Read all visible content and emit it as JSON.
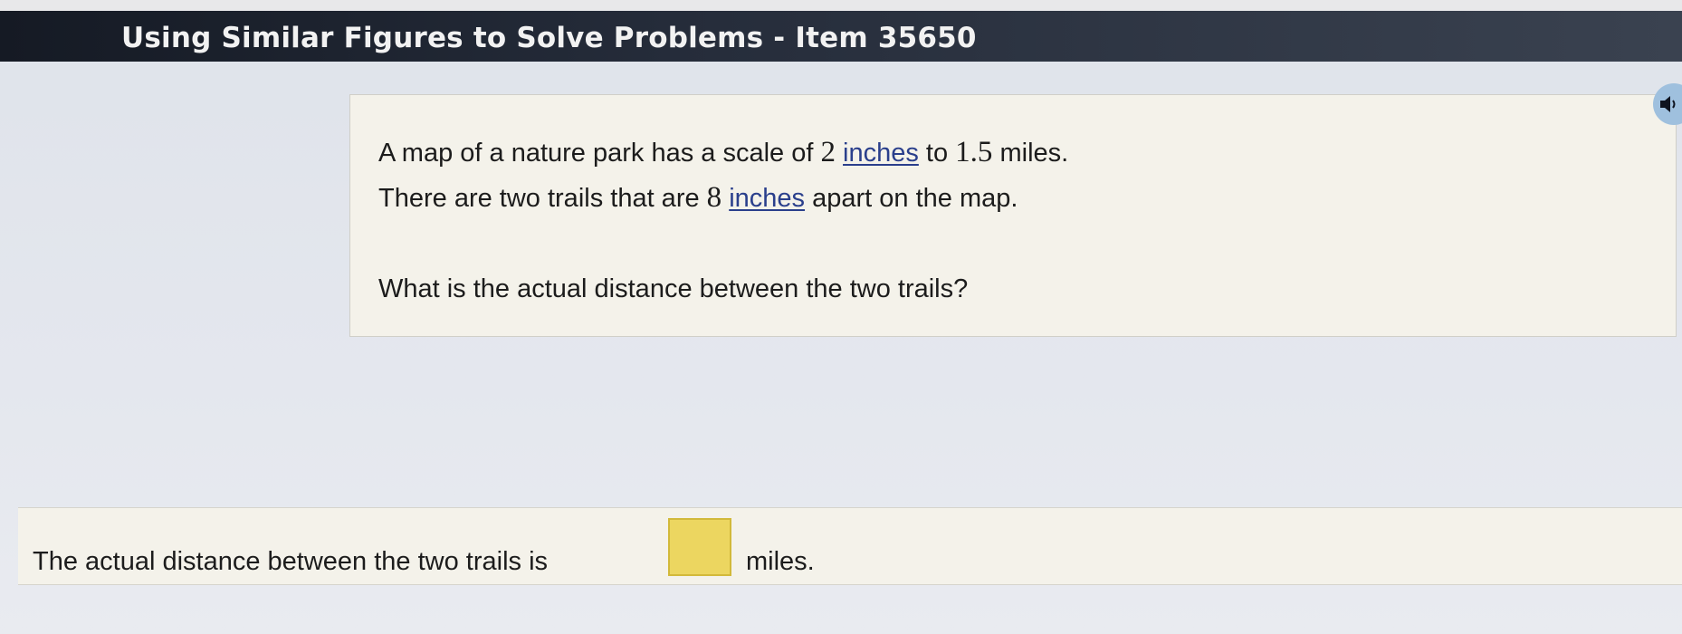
{
  "header": {
    "title": "Using Similar Figures to Solve Problems - Item 35650"
  },
  "question": {
    "line1": {
      "pre": "A map of a nature park has a scale of ",
      "num1": "2",
      "term1": "inches",
      "mid": " to ",
      "num2": "1.5",
      "post": " miles."
    },
    "line2": {
      "pre": "There are two trails that are ",
      "num": "8",
      "term": "inches",
      "post": " apart on the map."
    },
    "prompt": "What is the actual distance between the two trails?"
  },
  "answer": {
    "prefix": "The actual distance between the two trails is",
    "value": "",
    "suffix": "miles."
  },
  "icons": {
    "audio": "speaker-icon"
  },
  "colors": {
    "title_bar": "#1d2330",
    "card_bg": "#f4f2ea",
    "term_link": "#2a3f8c",
    "answer_box": "#ecd660",
    "audio_button": "#9fc0de"
  }
}
